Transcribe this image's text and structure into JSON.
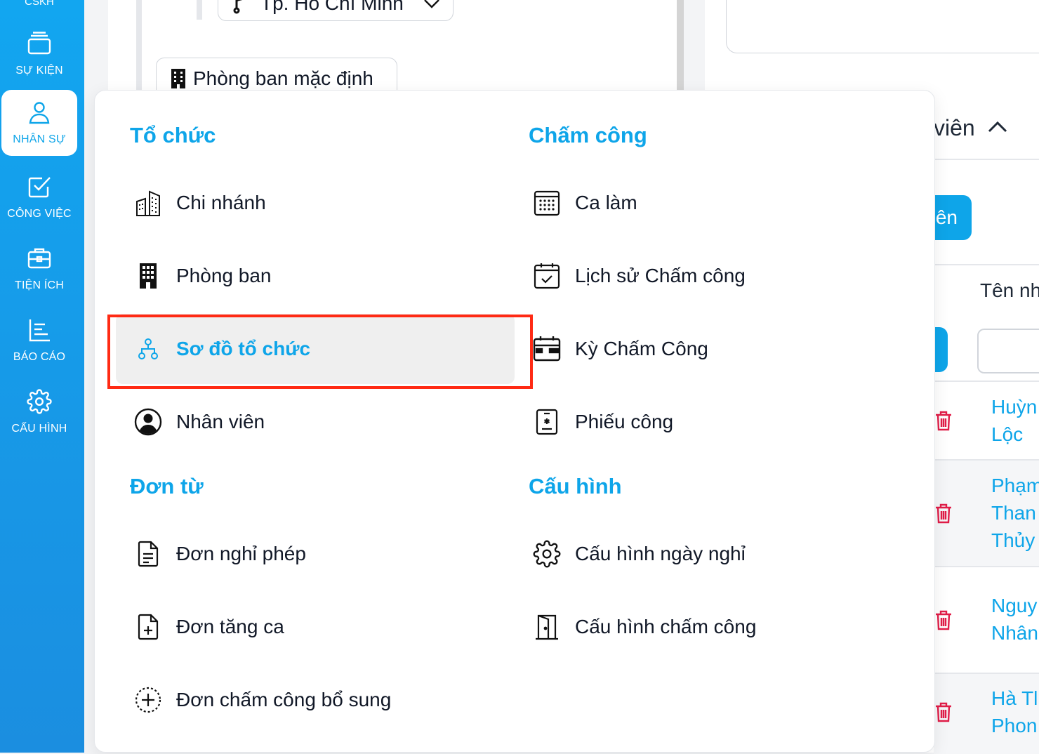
{
  "sidebar": {
    "top_label": "CSKH",
    "items": [
      {
        "label": "SỰ KIỆN",
        "icon": "cards-icon",
        "active": false
      },
      {
        "label": "NHÂN SỰ",
        "icon": "user-icon",
        "active": true
      },
      {
        "label": "CÔNG VIỆC",
        "icon": "checkbox-icon",
        "active": false
      },
      {
        "label": "TIỆN ÍCH",
        "icon": "briefcase-icon",
        "active": false
      },
      {
        "label": "BÁO CÁO",
        "icon": "report-icon",
        "active": false
      },
      {
        "label": "CẤU HÌNH",
        "icon": "gear-icon",
        "active": false
      }
    ]
  },
  "background": {
    "node_branch": "Tp. Hồ Chí Minh",
    "node_department": "Phòng ban mặc định",
    "section_title_partial": "viên",
    "add_button_partial": "ên",
    "column_header_partial": "Tên nh",
    "rows": [
      {
        "name_lines": [
          "Huỳn",
          "Lộc"
        ]
      },
      {
        "name_lines": [
          "Phạm",
          "Than",
          "Thủy"
        ]
      },
      {
        "name_lines": [
          "Nguy",
          "Nhân"
        ]
      },
      {
        "name_lines": [
          "Hà Tl",
          "Phon"
        ]
      }
    ]
  },
  "menu": {
    "to_chuc": {
      "title": "Tổ chức",
      "items": [
        {
          "label": "Chi nhánh",
          "icon": "buildings-icon"
        },
        {
          "label": "Phòng ban",
          "icon": "office-building-icon"
        },
        {
          "label": "Sơ đồ tổ chức",
          "icon": "org-chart-icon",
          "active": true
        },
        {
          "label": "Nhân viên",
          "icon": "user-circle-icon"
        }
      ]
    },
    "don_tu": {
      "title": "Đơn từ",
      "items": [
        {
          "label": "Đơn nghỉ phép",
          "icon": "document-icon"
        },
        {
          "label": "Đơn tăng ca",
          "icon": "document-plus-icon"
        },
        {
          "label": "Đơn chấm công bổ sung",
          "icon": "dashed-plus-circle-icon"
        }
      ]
    },
    "cham_cong": {
      "title": "Chấm công",
      "items": [
        {
          "label": "Ca làm",
          "icon": "calendar-grid-icon"
        },
        {
          "label": "Lịch sử Chấm công",
          "icon": "calendar-check-icon"
        },
        {
          "label": "Kỳ Chấm Công",
          "icon": "calendar-card-icon"
        },
        {
          "label": "Phiếu công",
          "icon": "badge-icon"
        }
      ]
    },
    "cau_hinh": {
      "title": "Cấu hình",
      "items": [
        {
          "label": "Cấu hình ngày nghỉ",
          "icon": "gear-icon"
        },
        {
          "label": "Cấu hình chấm công",
          "icon": "door-icon"
        }
      ]
    }
  },
  "colors": {
    "accent": "#0ea5e9",
    "highlight_border": "#ff2a14",
    "danger": "#e11d48"
  }
}
